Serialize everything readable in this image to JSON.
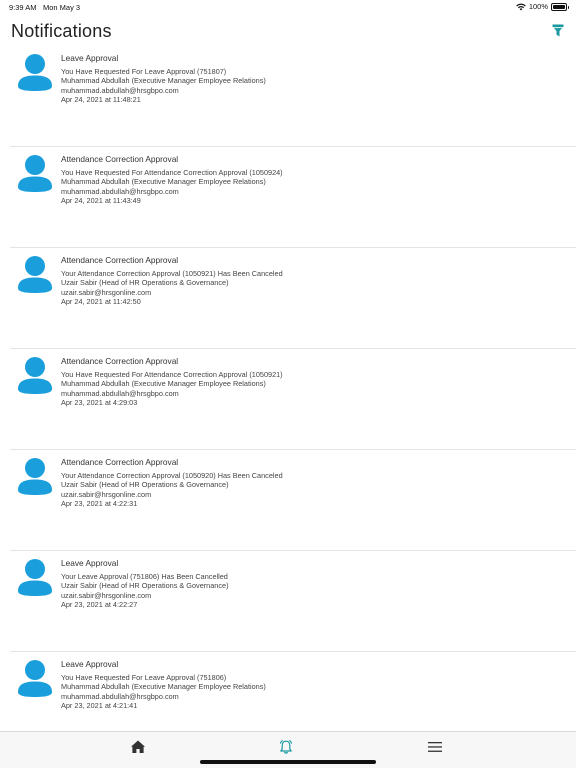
{
  "status_bar": {
    "time": "9:39 AM",
    "date": "Mon May 3",
    "battery": "100%"
  },
  "header": {
    "title": "Notifications"
  },
  "colors": {
    "accent": "#1a9fdc",
    "filter": "#1a9aa0"
  },
  "icons": {
    "filter": "filter-icon",
    "home": "home-icon",
    "notifications": "bell-icon",
    "menu": "hamburger-menu-icon",
    "avatar": "user-avatar-icon"
  },
  "notifications": [
    {
      "title": "Leave Approval",
      "message": "You Have Requested For Leave Approval (751807)",
      "person": "Muhammad Abdullah (Executive Manager Employee Relations)",
      "email": "muhammad.abdullah@hrsgbpo.com",
      "timestamp": "Apr 24, 2021 at 11:48:21"
    },
    {
      "title": "Attendance Correction Approval",
      "message": "You Have Requested For Attendance Correction Approval (1050924)",
      "person": "Muhammad Abdullah (Executive Manager Employee Relations)",
      "email": "muhammad.abdullah@hrsgbpo.com",
      "timestamp": "Apr 24, 2021 at 11:43:49"
    },
    {
      "title": "Attendance Correction Approval",
      "message": "Your Attendance Correction Approval (1050921) Has Been Canceled",
      "person": "Uzair Sabir (Head of HR Operations & Governance)",
      "email": "uzair.sabir@hrsgonline.com",
      "timestamp": "Apr 24, 2021 at 11:42:50"
    },
    {
      "title": "Attendance Correction Approval",
      "message": "You Have Requested For Attendance Correction Approval (1050921)",
      "person": "Muhammad Abdullah (Executive Manager Employee Relations)",
      "email": "muhammad.abdullah@hrsgbpo.com",
      "timestamp": "Apr 23, 2021 at 4:29:03"
    },
    {
      "title": "Attendance Correction Approval",
      "message": "Your Attendance Correction Approval (1050920) Has Been Canceled",
      "person": "Uzair Sabir (Head of HR Operations & Governance)",
      "email": "uzair.sabir@hrsgonline.com",
      "timestamp": "Apr 23, 2021 at 4:22:31"
    },
    {
      "title": "Leave Approval",
      "message": "Your Leave Approval (751806) Has Been Cancelled",
      "person": "Uzair Sabir (Head of HR Operations & Governance)",
      "email": "uzair.sabir@hrsgonline.com",
      "timestamp": "Apr 23, 2021 at 4:22:27"
    },
    {
      "title": "Leave Approval",
      "message": "You Have Requested For Leave Approval (751806)",
      "person": "Muhammad Abdullah (Executive Manager Employee Relations)",
      "email": "muhammad.abdullah@hrsgbpo.com",
      "timestamp": "Apr 23, 2021 at 4:21:41"
    }
  ],
  "tabbar": {
    "active": "notifications"
  }
}
